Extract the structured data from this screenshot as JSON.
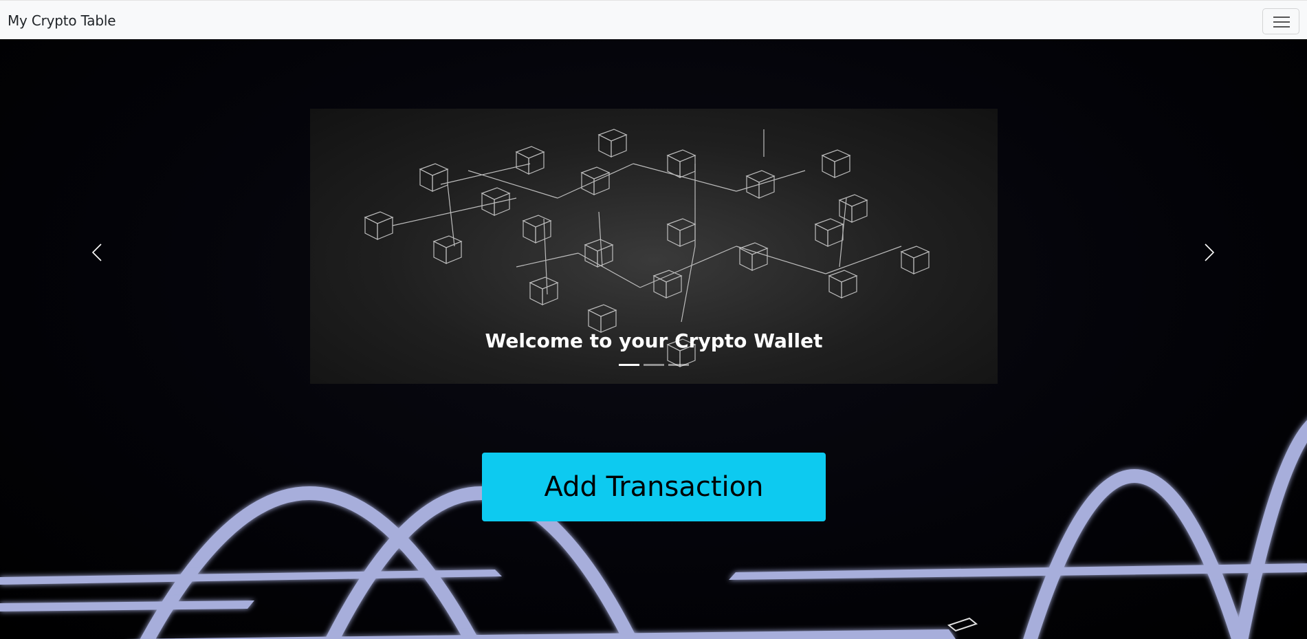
{
  "navbar": {
    "brand": "My Crypto Table",
    "menu_icon": "hamburger-icon"
  },
  "carousel": {
    "slides": [
      {
        "caption": "Welcome to your Crypto Wallet",
        "image": "blockchain-cubes-network"
      },
      {
        "caption": "",
        "image": ""
      },
      {
        "caption": "",
        "image": ""
      }
    ],
    "active_index": 0,
    "prev_icon": "chevron-left-icon",
    "next_icon": "chevron-right-icon"
  },
  "actions": {
    "add_transaction_label": "Add Transaction"
  },
  "colors": {
    "navbar_bg": "#f8f9fa",
    "button_bg": "#0dcaf0",
    "page_bg": "#000000",
    "arc_color": "#a7aedb"
  }
}
